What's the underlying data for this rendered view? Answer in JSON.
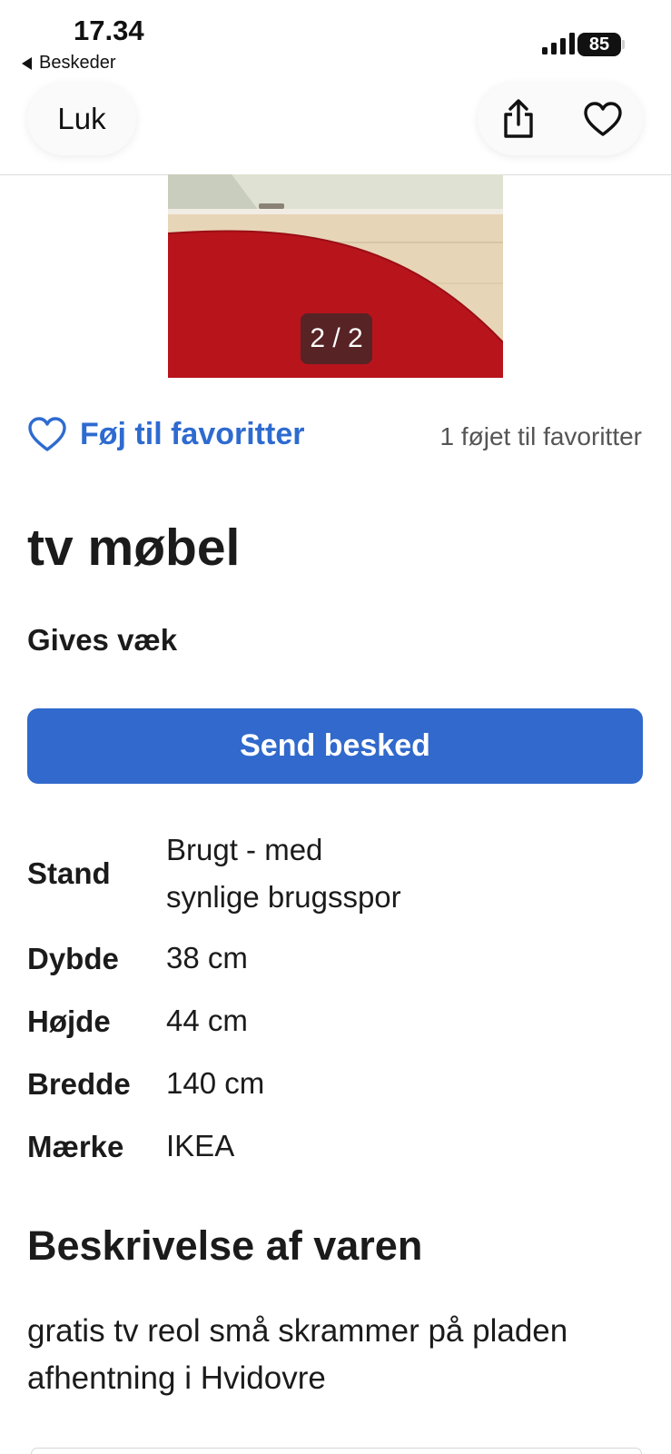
{
  "status_bar": {
    "time": "17.34",
    "back_app": "Beskeder",
    "battery": "85"
  },
  "header": {
    "close_label": "Luk"
  },
  "image": {
    "counter": "2 / 2"
  },
  "favorites": {
    "add_label": "Føj til favoritter",
    "count_text": "1 føjet til favoritter"
  },
  "listing": {
    "title": "tv møbel",
    "price": "Gives væk",
    "send_button": "Send besked",
    "attributes": [
      {
        "label": "Stand",
        "value_line1": "Brugt - med",
        "value_line2": "synlige brugsspor"
      },
      {
        "label": "Dybde",
        "value": "38 cm"
      },
      {
        "label": "Højde",
        "value": "44 cm"
      },
      {
        "label": "Bredde",
        "value": "140 cm"
      },
      {
        "label": "Mærke",
        "value": "IKEA"
      }
    ],
    "description_title": "Beskrivelse af varen",
    "description_line1": "gratis tv reol små skrammer på pladen",
    "description_line2": "afhentning i Hvidovre"
  },
  "colors": {
    "accent": "#3169cc",
    "link": "#2e6bd0",
    "photo_red": "#b8141c"
  },
  "icons": [
    "back-arrow-icon",
    "signal-icon",
    "wifi-icon",
    "battery-icon",
    "share-icon",
    "heart-icon"
  ]
}
